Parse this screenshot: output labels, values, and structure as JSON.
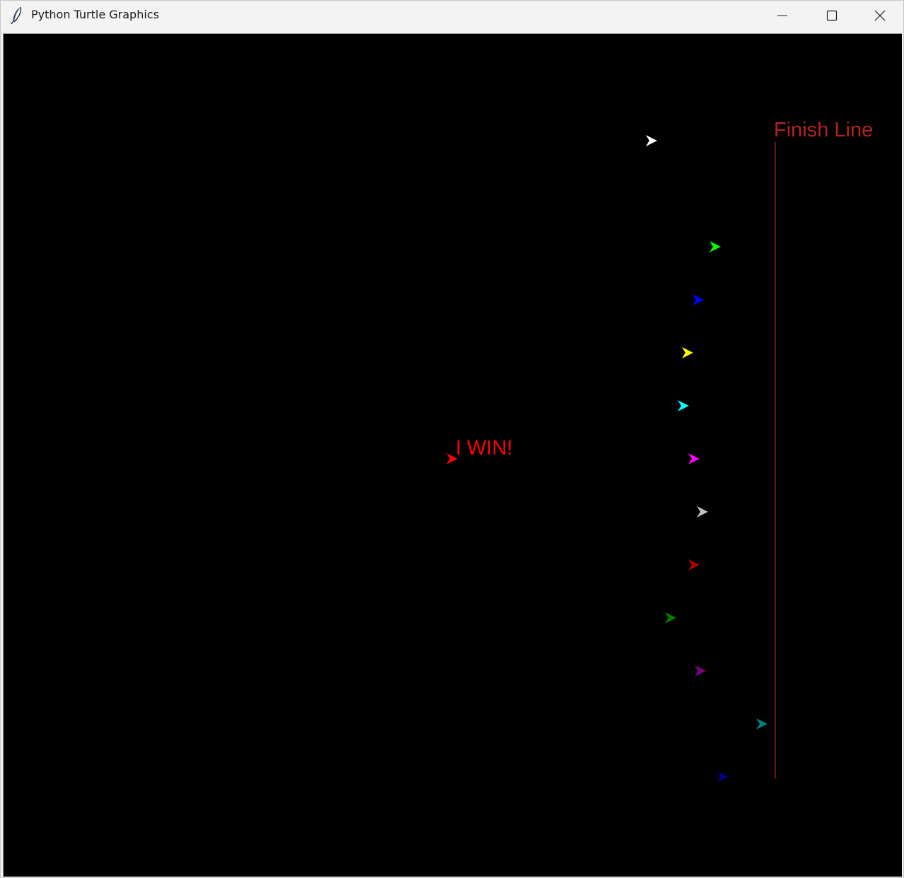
{
  "window": {
    "title": "Python Turtle Graphics"
  },
  "title_controls": {
    "minimize_icon": "minimize-icon",
    "maximize_icon": "maximize-icon",
    "close_icon": "close-icon"
  },
  "canvas": {
    "background": "#000000",
    "finish_line": {
      "label": "Finish Line",
      "color": "#b22222"
    },
    "winner_label": {
      "text": "I WIN!",
      "color": "#ff0000"
    },
    "turtles": [
      {
        "color": "#ffffff"
      },
      {
        "color": "#00ff00"
      },
      {
        "color": "#0000ff"
      },
      {
        "color": "#ffff00"
      },
      {
        "color": "#00ffff"
      },
      {
        "color": "#ff00ff"
      },
      {
        "color": "#c0c0c0"
      },
      {
        "color": "#b00000"
      },
      {
        "color": "#008000"
      },
      {
        "color": "#800080"
      },
      {
        "color": "#008080"
      },
      {
        "color": "#000080"
      },
      {
        "color": "#ff0000"
      }
    ]
  }
}
